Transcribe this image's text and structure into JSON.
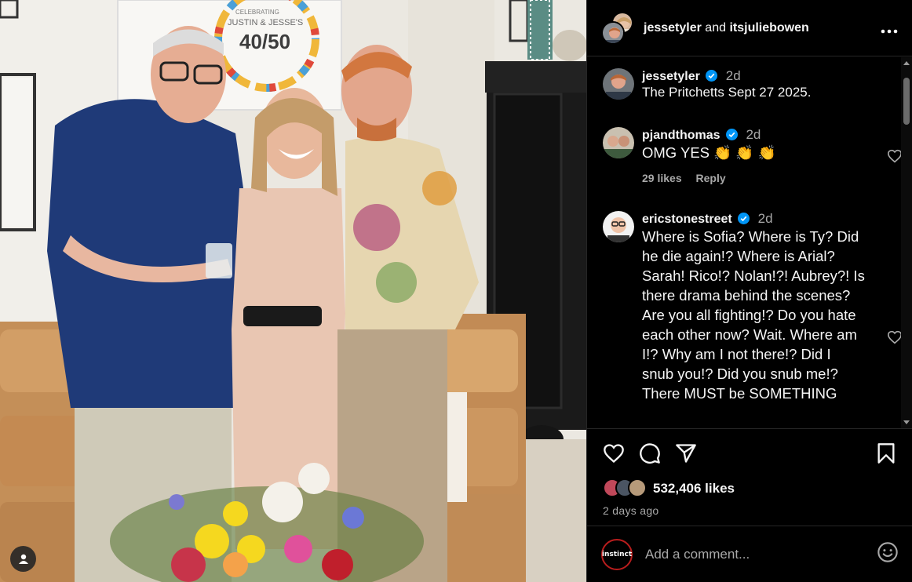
{
  "photo": {
    "sign_top": "CELEBRATING",
    "sign_names": "JUSTIN & JESSE'S",
    "sign_number": "40/50"
  },
  "header": {
    "user1": "jessetyler",
    "and_text": "and",
    "user2": "itsjuliebowen",
    "more_icon": "ellipsis-icon"
  },
  "caption": {
    "username": "jessetyler",
    "time": "2d",
    "text": "The Pritchetts Sept 27 2025."
  },
  "comments": [
    {
      "username": "pjandthomas",
      "time": "2d",
      "text": "OMG YES 👏 👏 👏",
      "likes": "29 likes",
      "reply": "Reply"
    },
    {
      "username": "ericstonestreet",
      "time": "2d",
      "text": "Where is Sofia? Where is Ty? Did he die again!? Where is Arial? Sarah! Rico!? Nolan!?! Aubrey?! Is there drama behind the scenes? Are you all fighting!? Do you hate each other now? Wait. Where am I!? Why am I not there!? Did I snub you!? Did you snub me!? There MUST be SOMETHING"
    }
  ],
  "post": {
    "likes": "532,406 likes",
    "ago": "2 days ago"
  },
  "add_comment": {
    "avatar_label": "instinct",
    "placeholder": "Add a comment..."
  },
  "colors": {
    "background": "#000000",
    "text": "#f5f5f5",
    "muted": "#a8a8a8",
    "verified": "#0095f6"
  }
}
